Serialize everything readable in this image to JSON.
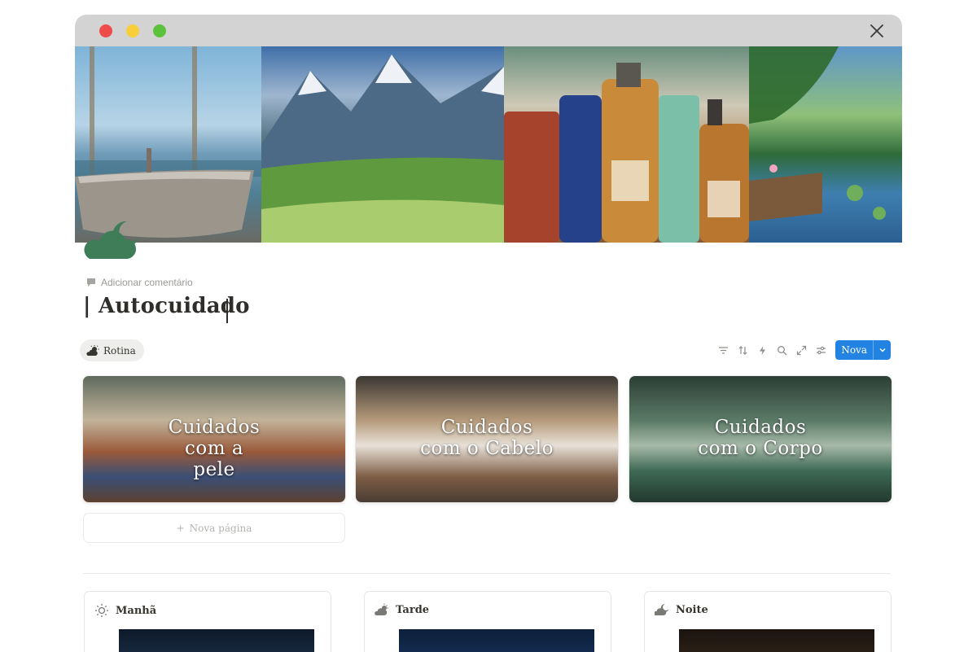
{
  "window": {
    "controls": [
      "close",
      "minimize",
      "maximize"
    ],
    "close_icon": "close-icon"
  },
  "cover": {
    "panels": [
      "bathtub-sea-view",
      "mountain-valley",
      "skincare-bottles",
      "lake-dock"
    ]
  },
  "page": {
    "icon": "cloud-moon-icon",
    "icon_color": "#3f7d58",
    "add_comment": "Adicionar comentário",
    "title": "| Autocuidado"
  },
  "views": {
    "active_tab": "Rotina",
    "toolbar_icons": [
      "filter-icon",
      "sort-icon",
      "automation-icon",
      "search-icon",
      "expand-icon",
      "settings-icon"
    ],
    "new_button": "Nova",
    "new_button_color": "#2383e2"
  },
  "gallery": {
    "cards": [
      {
        "title": "Cuidados com a pele"
      },
      {
        "title": "Cuidados com o Cabelo"
      },
      {
        "title": "Cuidados com o Corpo"
      }
    ],
    "new_page": "Nova página"
  },
  "routine": {
    "columns": [
      {
        "label": "Manhã",
        "icon": "sun-icon"
      },
      {
        "label": "Tarde",
        "icon": "sun-cloud-icon"
      },
      {
        "label": "Noite",
        "icon": "moon-cloud-icon"
      }
    ]
  }
}
